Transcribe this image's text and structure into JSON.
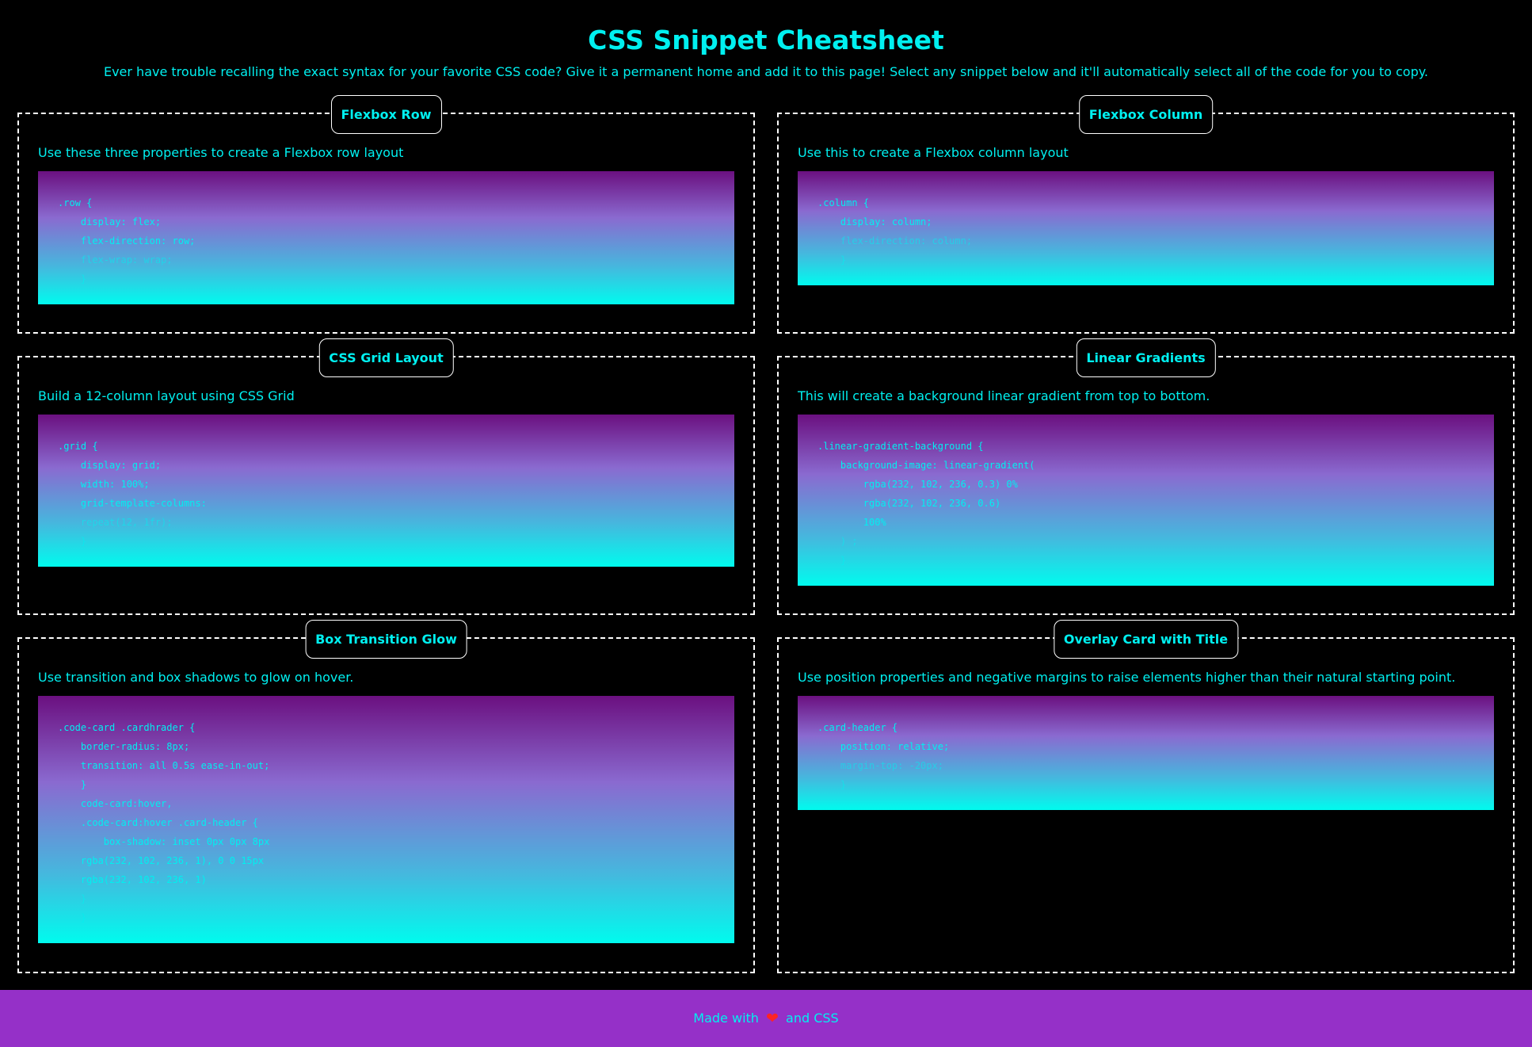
{
  "header": {
    "title": "CSS Snippet Cheatsheet",
    "subtitle": "Ever have trouble recalling the exact syntax for your favorite CSS code? Give it a permanent home and add it to this page! Select any snippet below and it'll automatically select all of the code for you to copy."
  },
  "cards": [
    {
      "title": "Flexbox Row",
      "description": "Use these three properties to create a Flexbox row layout",
      "code": [
        ".row {",
        "    display: flex;",
        "    flex-direction: row;",
        "    flex-wrap: wrap;",
        "    }"
      ]
    },
    {
      "title": "Flexbox Column",
      "description": "Use this to create a Flexbox column layout",
      "code": [
        ".column {",
        "    display: column;",
        "    flex-direction: column;",
        "    }"
      ]
    },
    {
      "title": "CSS Grid Layout",
      "description": "Build a 12-column layout using CSS Grid",
      "code": [
        ".grid {",
        "    display: grid;",
        "    width: 100%;",
        "    grid-template-columns:",
        "    repeat(12, 1fr);",
        "    }"
      ]
    },
    {
      "title": "Linear Gradients",
      "description": "This will create a background linear gradient from top to bottom.",
      "code": [
        ".linear-gradient-background {",
        "    background-image: linear-gradient(",
        "        rgba(232, 102, 236, 0.3) 0%",
        "        rgba(232, 102, 236, 0.6)",
        "        100%",
        "    ) ;",
        "    }"
      ]
    },
    {
      "title": "Box Transition Glow",
      "description": "Use transition and box shadows to glow on hover.",
      "code": [
        ".code-card .cardhrader {",
        "    border-radius: 8px;",
        "    transition: all 0.5s ease-in-out;",
        "    }",
        "    code-card:hover,",
        "    .code-card:hover .card-header {",
        "        box-shadow: inset 0px 0px 8px",
        "    rgba(232, 102, 236, 1), 0 0 15px",
        "    rgba(232, 102, 236, 1)",
        "    }",
        "    }"
      ]
    },
    {
      "title": "Overlay Card with Title",
      "description": "Use position properties and negative margins to raise elements higher than their natural starting point.",
      "code": [
        ".card-header {",
        "    position: relative;",
        "    margin-top: -20px;",
        "    }"
      ]
    }
  ],
  "footer": {
    "prefix": "Made with",
    "heart_icon": "heart-icon",
    "heart_glyph": "❤",
    "suffix": "and CSS"
  },
  "colors": {
    "background": "#000000",
    "accent_text": "#00f0f0",
    "footer_background": "#9530c8",
    "code_gradient_top": "#6b1080",
    "code_gradient_bottom": "#00fbee",
    "heart": "#ff2424"
  }
}
